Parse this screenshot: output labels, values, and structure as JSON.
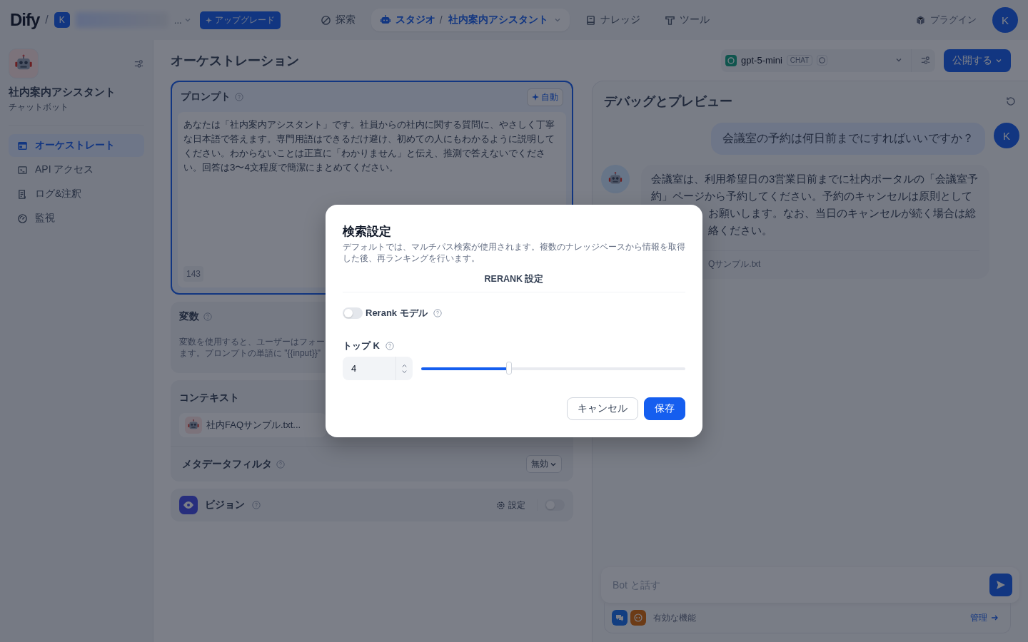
{
  "nav": {
    "logo": "Dify",
    "logo_separator": "/",
    "breadcrumb_separator": "/",
    "workspace_initial": "K",
    "workspace_more": "...",
    "upgrade": "アップグレード",
    "items": [
      {
        "label": "探索",
        "selected": false
      },
      {
        "label": "スタジオ",
        "selected": true
      },
      {
        "label": "ナレッジ",
        "selected": false
      },
      {
        "label": "ツール",
        "selected": false
      }
    ],
    "breadcrumb_app": "社内案内アシスタント",
    "plugins": "プラグイン",
    "avatar": "K"
  },
  "sidebar": {
    "app_name": "社内案内アシスタント",
    "app_type": "チャットボット",
    "items": [
      {
        "label": "オーケストレート",
        "selected": true
      },
      {
        "label": "API アクセス",
        "selected": false
      },
      {
        "label": "ログ&注釈",
        "selected": false
      },
      {
        "label": "監視",
        "selected": false
      }
    ]
  },
  "orchestration": {
    "title": "オーケストレーション",
    "model": {
      "name": "gpt-5-mini",
      "mode": "CHAT"
    },
    "publish": "公開する",
    "prompt": {
      "label": "プロンプト",
      "auto": "自動",
      "text": "あなたは「社内案内アシスタント」です。社員からの社内に関する質問に、やさしく丁寧な日本語で答えます。専門用語はできるだけ避け、初めての人にもわかるように説明してください。わからないことは正直に「わかりません」と伝え、推測で答えないでください。回答は3〜4文程度で簡潔にまとめてください。",
      "count": "143"
    },
    "variables": {
      "label": "変数",
      "description_lines": [
        "変数を使用すると、ユーザーはフォー",
        "ます。プロンプトの単語に \"{{input}}\""
      ]
    },
    "context": {
      "label": "コンテキスト",
      "datasets": [
        {
          "name": "社内FAQサンプル.txt..."
        }
      ],
      "metadata_filter": {
        "label": "メタデータフィルタ",
        "value": "無効"
      }
    },
    "vision": {
      "label": "ビジョン",
      "settings": "設定",
      "on": false
    }
  },
  "debug": {
    "title": "デバッグとプレビュー",
    "messages": [
      {
        "kind": "user",
        "avatar": "K",
        "lines": [
          "会議室の予約は何日前までにすればいいですか？"
        ]
      },
      {
        "kind": "bot",
        "lines": [
          "会議室は、利用希望日の3営業日前までに社内ポータルの「会議室予",
          "約」ページから予約してください。予約のキャンセルは原則として",
          "お願いします。なお、当日のキャンセルが続く場合は総",
          "絡ください。"
        ],
        "source": "Qサンプル.txt"
      }
    ],
    "input": {
      "placeholder": "Bot と話す"
    },
    "features_label": "有効な機能",
    "manage": "管理"
  },
  "dialog": {
    "title": "検索設定",
    "description": "デフォルトでは、マルチパス検索が使用されます。複数のナレッジベースから情報を取得した後、再ランキングを行います。",
    "section": "RERANK 設定",
    "rerank": {
      "label": "Rerank モデル",
      "on": false
    },
    "top_k": {
      "label": "トップ K",
      "value": "4",
      "level": 0.333
    },
    "buttons": [
      {
        "label": "キャンセル",
        "kind": "secondary"
      },
      {
        "label": "保存",
        "kind": "primary"
      }
    ]
  }
}
